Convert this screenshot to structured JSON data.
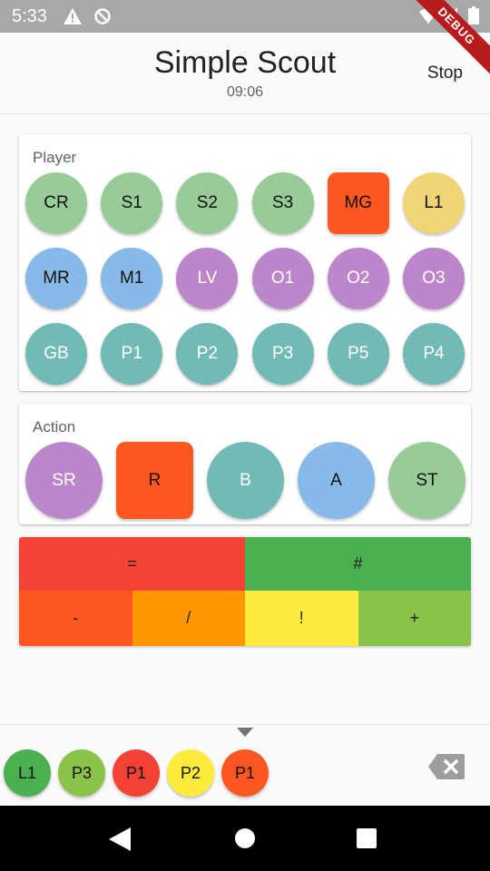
{
  "status_bar": {
    "time": "5:33",
    "icons": [
      "warning-icon",
      "sync-disabled-icon",
      "wifi-icon",
      "signal-icon",
      "battery-icon"
    ]
  },
  "debug_banner": {
    "label": "DEBUG",
    "color": "#b71c1c"
  },
  "app_bar": {
    "title": "Simple Scout",
    "timer": "09:06",
    "stop_label": "Stop"
  },
  "player_section": {
    "label": "Player",
    "buttons": [
      {
        "label": "CR",
        "color": "#97cb97",
        "shape": "circle"
      },
      {
        "label": "S1",
        "color": "#97cb97",
        "shape": "circle"
      },
      {
        "label": "S2",
        "color": "#97cb97",
        "shape": "circle"
      },
      {
        "label": "S3",
        "color": "#97cb97",
        "shape": "circle"
      },
      {
        "label": "MG",
        "color": "#ff5722",
        "shape": "square"
      },
      {
        "label": "L1",
        "color": "#f0d478",
        "shape": "circle"
      },
      {
        "label": "MR",
        "color": "#87bae9",
        "shape": "circle"
      },
      {
        "label": "M1",
        "color": "#87bae9",
        "shape": "circle"
      },
      {
        "label": "LV",
        "color": "#bd86cb",
        "shape": "circle"
      },
      {
        "label": "O1",
        "color": "#bd86cb",
        "shape": "circle"
      },
      {
        "label": "O2",
        "color": "#bd86cb",
        "shape": "circle"
      },
      {
        "label": "O3",
        "color": "#bd86cb",
        "shape": "circle"
      },
      {
        "label": "GB",
        "color": "#72bab5",
        "shape": "circle"
      },
      {
        "label": "P1",
        "color": "#72bab5",
        "shape": "circle"
      },
      {
        "label": "P2",
        "color": "#72bab5",
        "shape": "circle"
      },
      {
        "label": "P3",
        "color": "#72bab5",
        "shape": "circle"
      },
      {
        "label": "P5",
        "color": "#72bab5",
        "shape": "circle"
      },
      {
        "label": "P4",
        "color": "#72bab5",
        "shape": "circle"
      }
    ]
  },
  "action_section": {
    "label": "Action",
    "buttons": [
      {
        "label": "SR",
        "color": "#bd86cb",
        "shape": "circle"
      },
      {
        "label": "R",
        "color": "#ff5722",
        "shape": "square"
      },
      {
        "label": "B",
        "color": "#72bab5",
        "shape": "circle"
      },
      {
        "label": "A",
        "color": "#87bae9",
        "shape": "circle"
      },
      {
        "label": "ST",
        "color": "#97cb97",
        "shape": "circle"
      }
    ]
  },
  "result_panel": {
    "row1": [
      {
        "label": "=",
        "color": "#f44336"
      },
      {
        "label": "#",
        "color": "#4caf50"
      }
    ],
    "row2": [
      {
        "label": "-",
        "color": "#ff5722"
      },
      {
        "label": "/",
        "color": "#ff9800"
      },
      {
        "label": "!",
        "color": "#ffeb3b"
      },
      {
        "label": "+",
        "color": "#8bc34a"
      }
    ]
  },
  "history": {
    "items": [
      {
        "label": "L1",
        "color": "#4caf50"
      },
      {
        "label": "P3",
        "color": "#8bc34a"
      },
      {
        "label": "P1",
        "color": "#f44336"
      },
      {
        "label": "P2",
        "color": "#ffeb3b"
      },
      {
        "label": "P1",
        "color": "#ff5722"
      }
    ],
    "backspace_icon": "backspace-icon"
  },
  "nav_bar": {
    "icons": [
      "back-icon",
      "home-icon",
      "recents-icon"
    ]
  }
}
